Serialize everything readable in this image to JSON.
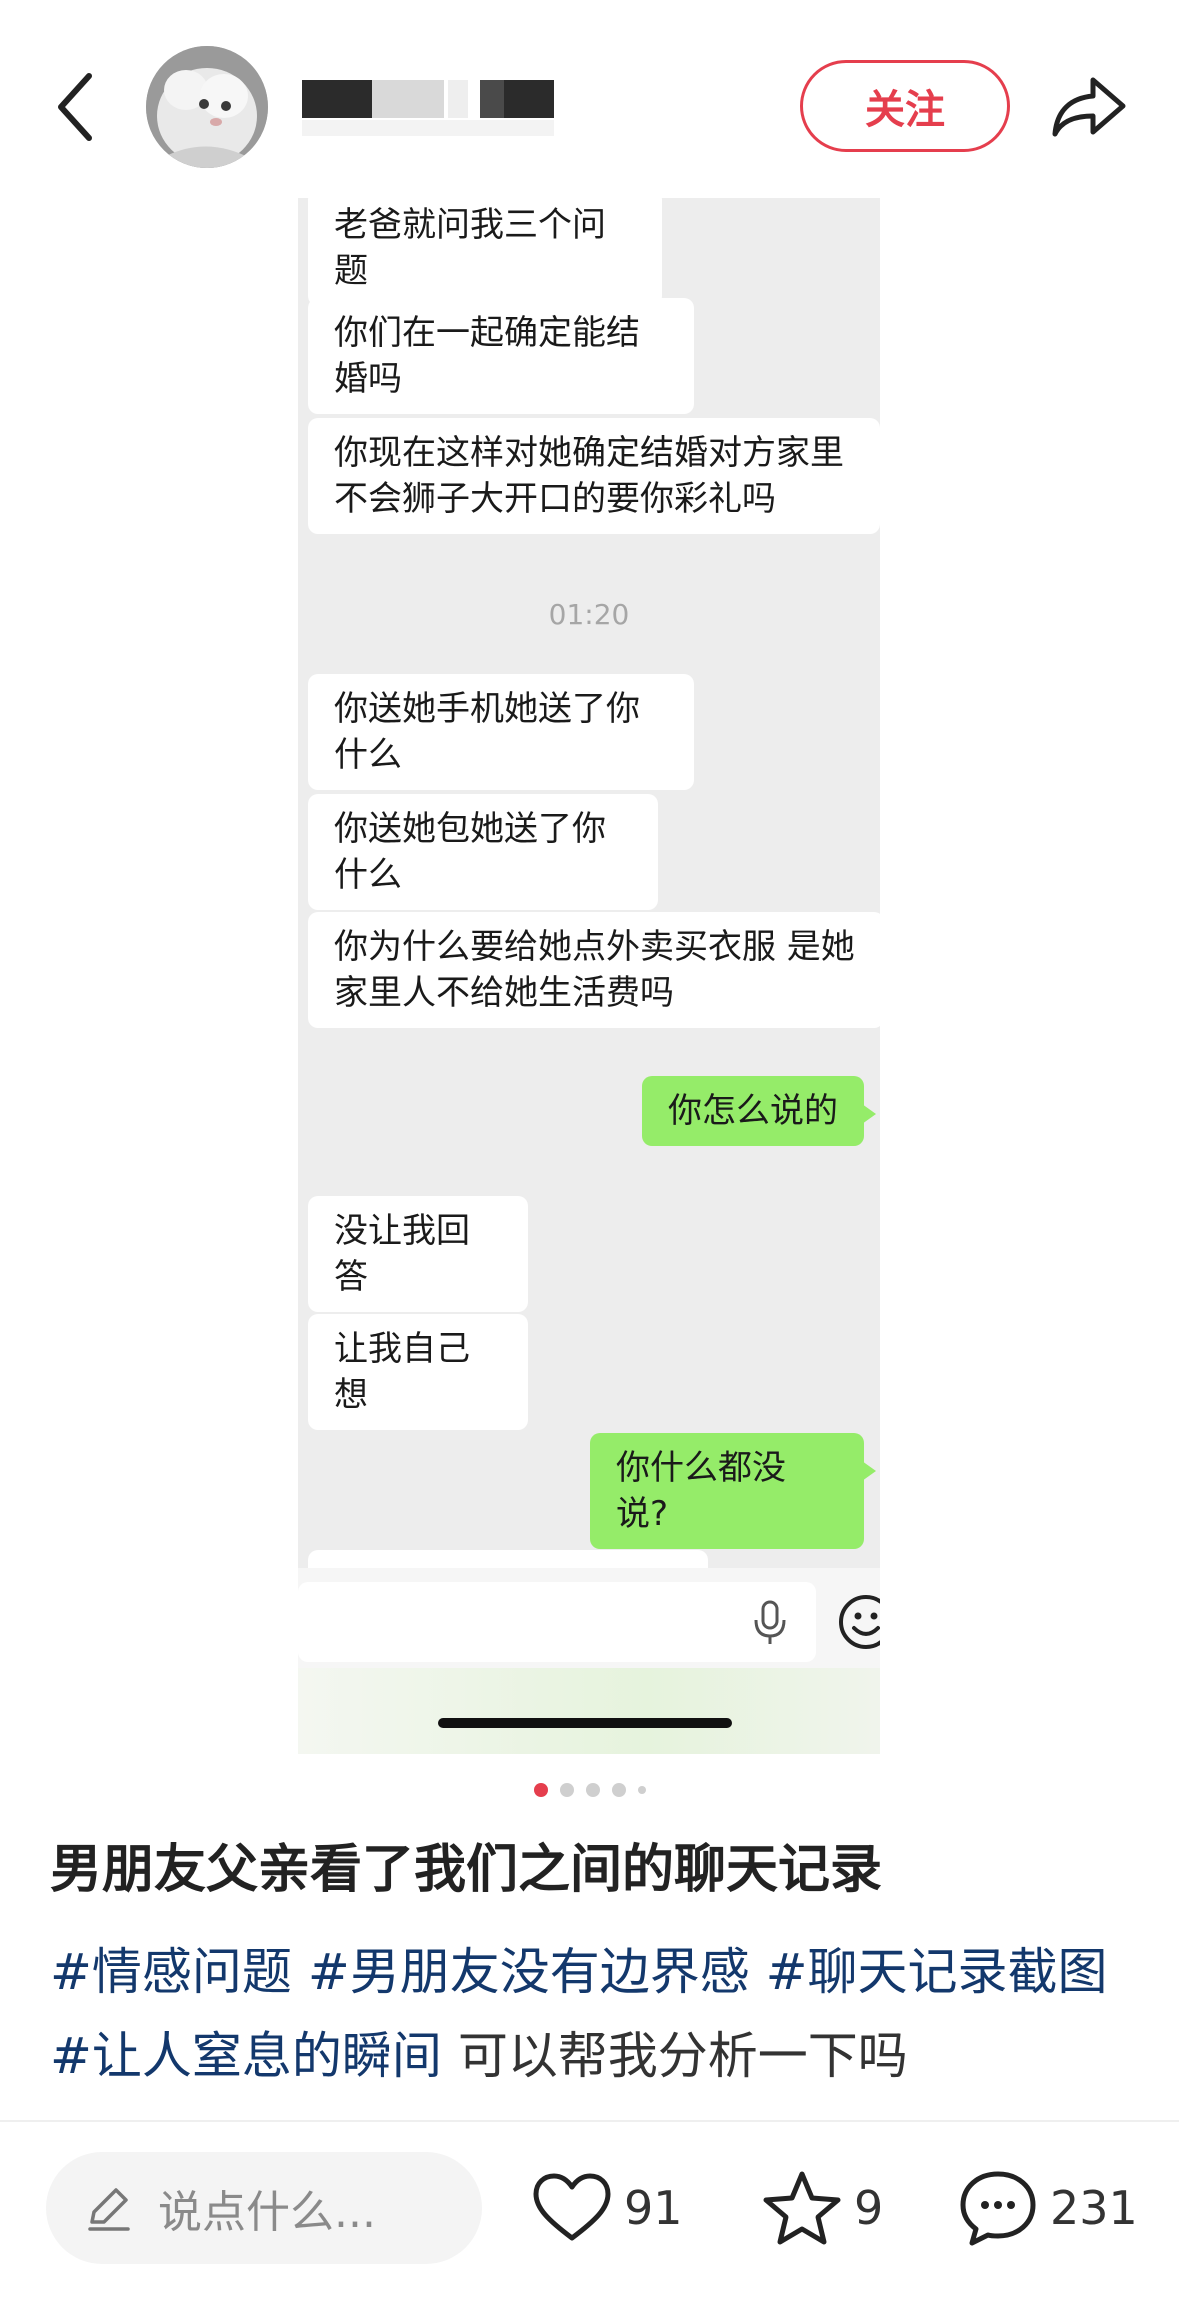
{
  "header": {
    "follow_label": "关注"
  },
  "chat": {
    "messages": [
      {
        "side": "left",
        "text": "老爸就问我三个问题"
      },
      {
        "side": "left",
        "text": "你们在一起确定能结婚吗"
      },
      {
        "side": "left",
        "text": "你现在这样对她确定结婚对方家里不会狮子大开口的要你彩礼吗"
      },
      {
        "side": "left",
        "text": "你送她手机她送了你什么"
      },
      {
        "side": "left",
        "text": "你送她包她送了你什么"
      },
      {
        "side": "left",
        "text": "你为什么要给她点外卖买衣服 是她家里人不给她生活费吗"
      },
      {
        "side": "right",
        "text": "你怎么说的"
      },
      {
        "side": "left",
        "text": "没让我回答"
      },
      {
        "side": "left",
        "text": "让我自己想"
      },
      {
        "side": "right",
        "text": "你什么都没说?"
      }
    ],
    "timestamp": "01:20"
  },
  "pagination": {
    "total": 5,
    "active": 1
  },
  "post": {
    "title": "男朋友父亲看了我们之间的聊天记录",
    "tags": [
      "#情感问题",
      "#男朋友没有边界感",
      "#聊天记录截图",
      "#让人窒息的瞬间"
    ],
    "text_after_tags": "可以帮我分析一下吗"
  },
  "bottom_bar": {
    "comment_placeholder": "说点什么...",
    "likes": "91",
    "favorites": "9",
    "comments": "231"
  },
  "colors": {
    "accent": "#e53e4d",
    "tag": "#13386c",
    "chat_bg": "#ededed",
    "bubble_right": "#95ec69"
  }
}
